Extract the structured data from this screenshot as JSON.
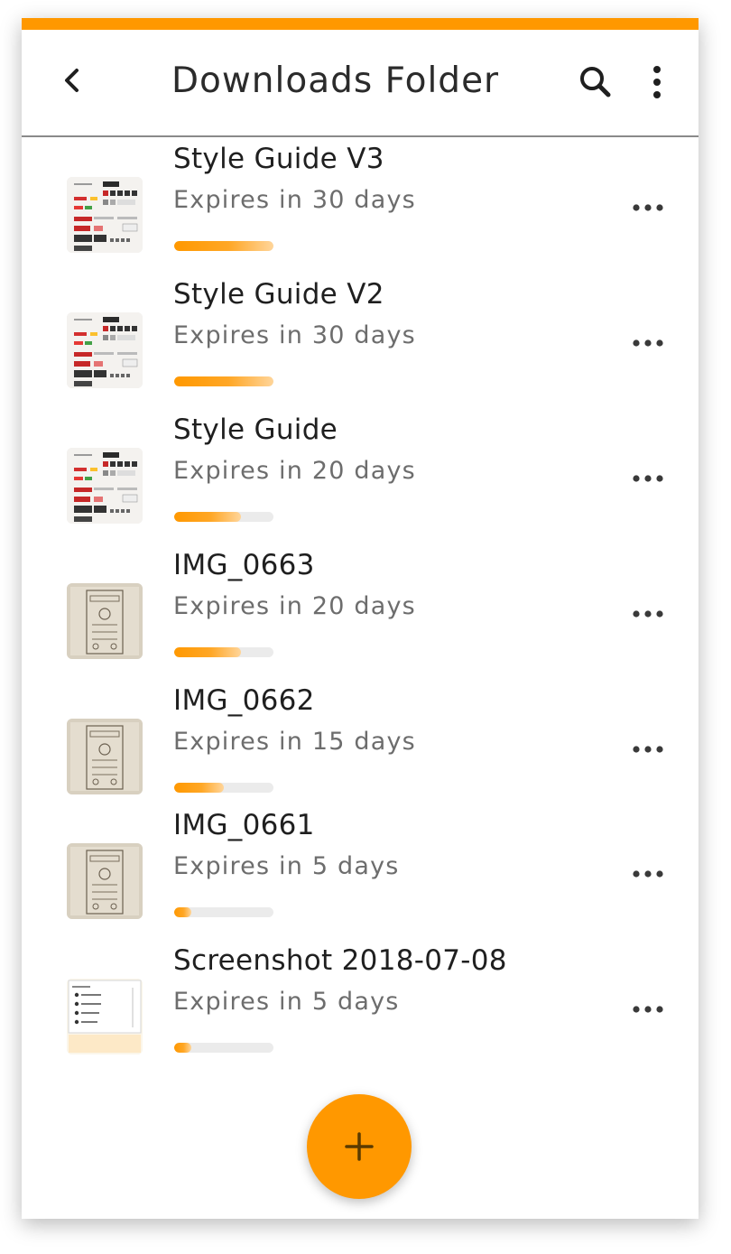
{
  "app_bar": {
    "title": "Downloads Folder",
    "back_icon": "chevron-left-icon",
    "search_icon": "search-icon",
    "more_icon": "more-vertical-icon"
  },
  "colors": {
    "accent": "#ff9800",
    "text_primary": "#1f1f1f",
    "text_secondary": "#6d6d6d",
    "track": "#ebebeb"
  },
  "files": [
    {
      "name": "Style Guide V3",
      "expires": "Expires in 30 days",
      "progress": 1.0,
      "thumb": "style-guide"
    },
    {
      "name": "Style Guide V2",
      "expires": "Expires in 30 days",
      "progress": 1.0,
      "thumb": "style-guide"
    },
    {
      "name": "Style Guide",
      "expires": "Expires in 20 days",
      "progress": 0.67,
      "thumb": "style-guide"
    },
    {
      "name": "IMG_0663",
      "expires": "Expires in 20 days",
      "progress": 0.67,
      "thumb": "sketch"
    },
    {
      "name": "IMG_0662",
      "expires": "Expires in 15 days",
      "progress": 0.5,
      "thumb": "sketch"
    },
    {
      "name": "IMG_0661",
      "expires": "Expires in 5 days",
      "progress": 0.17,
      "thumb": "sketch"
    },
    {
      "name": "Screenshot 2018-07-08",
      "expires": "Expires in 5 days",
      "progress": 0.17,
      "thumb": "screenshot"
    }
  ],
  "fab": {
    "icon": "plus-icon"
  }
}
